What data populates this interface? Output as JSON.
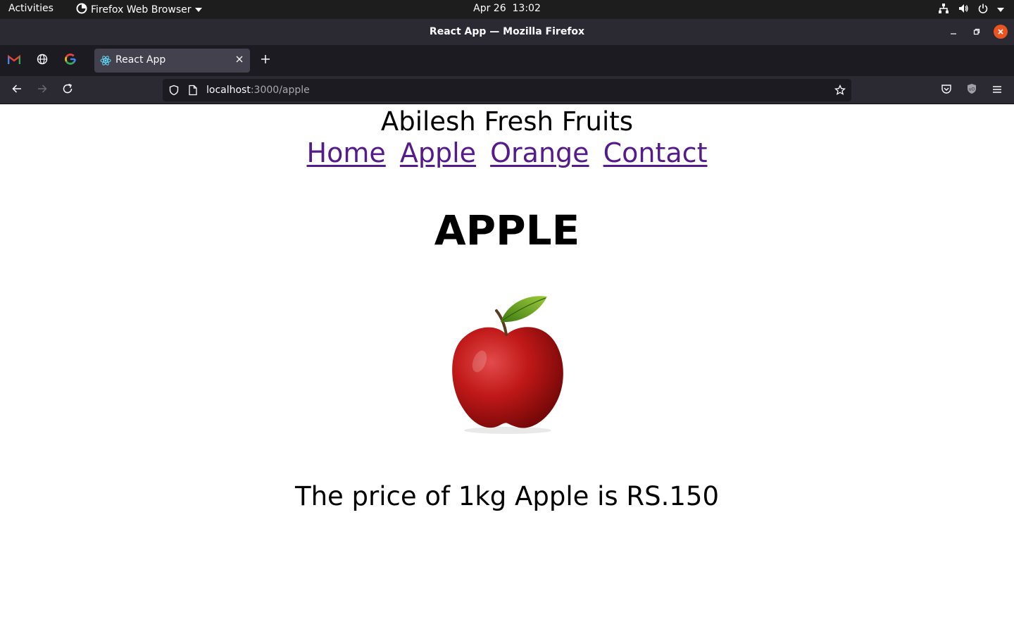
{
  "system_bar": {
    "activities": "Activities",
    "app_menu": "Firefox Web Browser",
    "date": "Apr 26",
    "time": "13:02"
  },
  "window": {
    "title": "React App — Mozilla Firefox"
  },
  "tabs": {
    "pinned": [
      {
        "name": "gmail-icon"
      },
      {
        "name": "globe-icon"
      },
      {
        "name": "google-icon"
      }
    ],
    "active": {
      "title": "React App",
      "icon": "react-icon"
    }
  },
  "navbar": {
    "url_host": "localhost",
    "url_rest": ":3000/apple"
  },
  "page": {
    "site_title": "Abilesh Fresh Fruits",
    "nav": [
      "Home",
      "Apple",
      "Orange",
      "Contact"
    ],
    "heading": "APPLE",
    "image_alt": "red-apple-image",
    "price_text": "The price of 1kg Apple is RS.150"
  },
  "colors": {
    "link_visited": "#551a8b",
    "close_button": "#e95420",
    "toolbar_bg": "#2b2a33",
    "tabbar_bg": "#1c1b22"
  }
}
